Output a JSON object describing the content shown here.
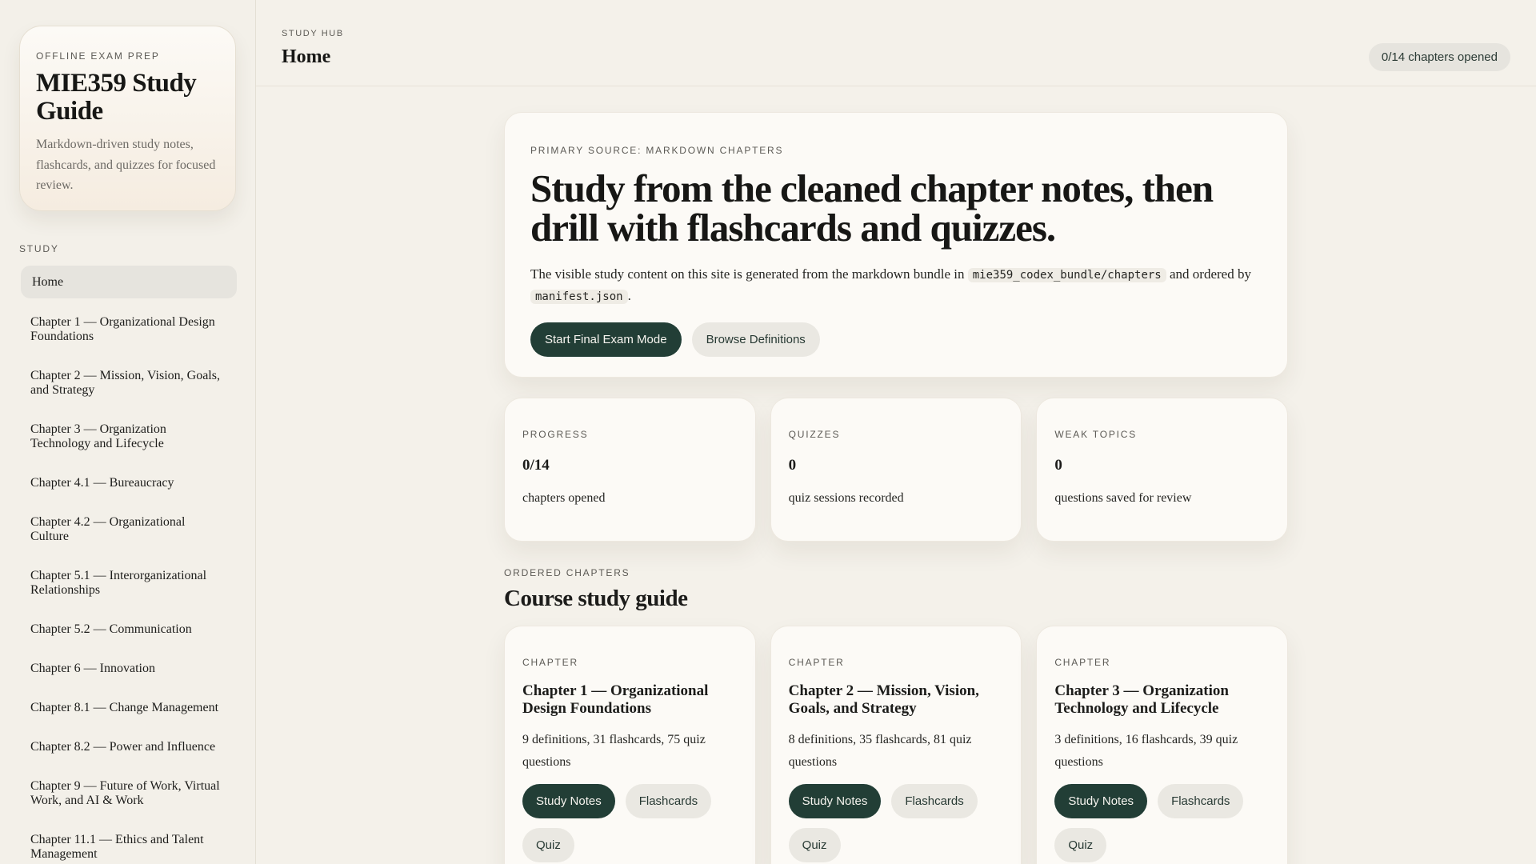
{
  "sidebar": {
    "brand": {
      "eyebrow": "OFFLINE EXAM PREP",
      "title": "MIE359 Study Guide",
      "description": "Markdown-driven study notes, flashcards, and quizzes for focused review."
    },
    "nav_heading": "STUDY",
    "items": [
      {
        "label": "Home"
      },
      {
        "label": "Chapter 1 — Organizational Design Foundations"
      },
      {
        "label": "Chapter 2 — Mission, Vision, Goals, and Strategy"
      },
      {
        "label": "Chapter 3 — Organization Technology and Lifecycle"
      },
      {
        "label": "Chapter 4.1 — Bureaucracy"
      },
      {
        "label": "Chapter 4.2 — Organizational Culture"
      },
      {
        "label": "Chapter 5.1 — Interorganizational Relationships"
      },
      {
        "label": "Chapter 5.2 — Communication"
      },
      {
        "label": "Chapter 6 — Innovation"
      },
      {
        "label": "Chapter 8.1 — Change Management"
      },
      {
        "label": "Chapter 8.2 — Power and Influence"
      },
      {
        "label": "Chapter 9 — Future of Work, Virtual Work, and AI & Work"
      },
      {
        "label": "Chapter 11.1 — Ethics and Talent Management"
      }
    ]
  },
  "header": {
    "eyebrow": "STUDY HUB",
    "title": "Home",
    "progress_chip": "0/14 chapters opened"
  },
  "hero": {
    "eyebrow": "PRIMARY SOURCE: MARKDOWN CHAPTERS",
    "title": "Study from the cleaned chapter notes, then drill with flashcards and quizzes.",
    "desc_before": "The visible study content on this site is generated from the markdown bundle in",
    "code_path": "mie359_codex_bundle/chapters",
    "desc_middle": "and ordered by",
    "code_manifest": "manifest.json",
    "desc_after": ".",
    "primary_button": "Start Final Exam Mode",
    "secondary_button": "Browse Definitions"
  },
  "stats": [
    {
      "eyebrow": "PROGRESS",
      "value": "0/14",
      "label": "chapters opened"
    },
    {
      "eyebrow": "QUIZZES",
      "value": "0",
      "label": "quiz sessions recorded"
    },
    {
      "eyebrow": "WEAK TOPICS",
      "value": "0",
      "label": "questions saved for review"
    }
  ],
  "section": {
    "eyebrow": "ORDERED CHAPTERS",
    "title": "Course study guide"
  },
  "chapters": [
    {
      "eyebrow": "CHAPTER",
      "title": "Chapter 1 — Organizational Design Foundations",
      "meta": "9 definitions, 31 flashcards, 75 quiz questions",
      "notes": "Study Notes",
      "flashcards": "Flashcards",
      "quiz": "Quiz"
    },
    {
      "eyebrow": "CHAPTER",
      "title": "Chapter 2 — Mission, Vision, Goals, and Strategy",
      "meta": "8 definitions, 35 flashcards, 81 quiz questions",
      "notes": "Study Notes",
      "flashcards": "Flashcards",
      "quiz": "Quiz"
    },
    {
      "eyebrow": "CHAPTER",
      "title": "Chapter 3 — Organization Technology and Lifecycle",
      "meta": "3 definitions, 16 flashcards, 39 quiz questions",
      "notes": "Study Notes",
      "flashcards": "Flashcards",
      "quiz": "Quiz"
    }
  ],
  "colors": {
    "background": "#f4f1ea",
    "primary_button": "#223e36",
    "secondary_button": "#eae8e2",
    "card": "#fcfaf6"
  }
}
